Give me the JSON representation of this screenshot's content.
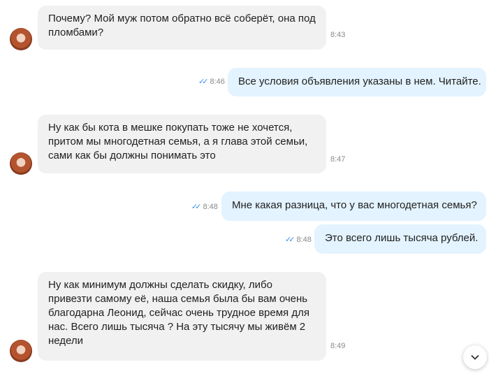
{
  "messages": [
    {
      "lines": [
        "Почему? Мой муж потом обратно всё соберёт, она под",
        "пломбами?"
      ],
      "time": "8:43"
    },
    {
      "lines": [
        "Все условия объявления указаны в нем. Читайте."
      ],
      "time": "8:46"
    },
    {
      "lines": [
        "Ну как бы кота в мешке покупать тоже не хочется,",
        "притом мы многодетная семья, а я глава этой семьи,",
        "сами как бы должны понимать это"
      ],
      "time": "8:47"
    },
    {
      "lines": [
        "Мне какая разница, что у вас многодетная семья?"
      ],
      "time": "8:48"
    },
    {
      "lines": [
        "Это всего лишь тысяча рублей."
      ],
      "time": "8:48"
    },
    {
      "lines": [
        "Ну как минимум должны сделать скидку, либо",
        "привезти самому её, наша семья была бы вам очень",
        "благодарна Леонид, сейчас очень трудное время для",
        "нас. Всего лишь тысяча ? На эту тысячу мы живём 2",
        "недели"
      ],
      "time": "8:49"
    }
  ],
  "icons": {
    "read_ticks": "double-check-icon",
    "scroll_down": "chevron-down-icon"
  },
  "colors": {
    "incoming_bubble": "#f1f1f1",
    "outgoing_bubble": "#e3f3ff",
    "read_ticks": "#3a8ee6",
    "timestamp": "#8a8a8a"
  }
}
